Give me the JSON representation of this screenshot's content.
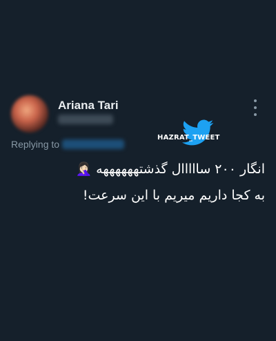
{
  "tweet": {
    "author_name": "Ariana Tari",
    "replying_label": "Replying to",
    "text_line_1": "انگار ۲۰۰ سااااال گذشتههههههه 🤦🏻‍♀️",
    "text_line_2": "به کجا داریم میریم با این سرعت!"
  },
  "watermark": {
    "text": "HAZRAT_TWEET",
    "icon": "twitter-bird-icon"
  },
  "icons": {
    "more": "more-options-icon"
  },
  "colors": {
    "background": "#15202b",
    "secondary_text": "#8899a6",
    "twitter_blue": "#1da1f2"
  }
}
